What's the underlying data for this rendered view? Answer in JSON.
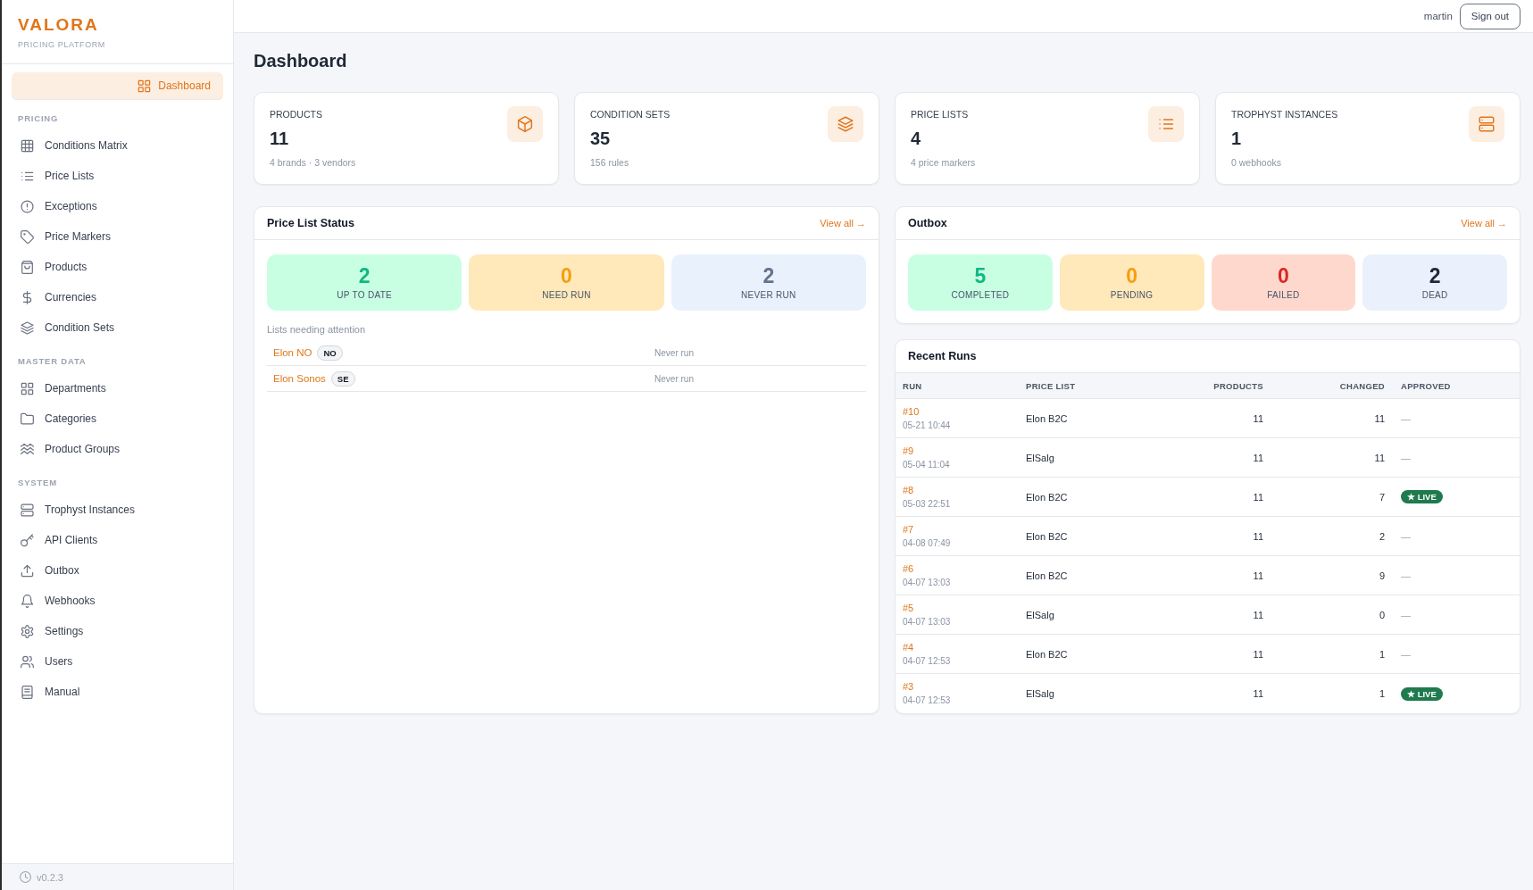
{
  "sidebar": {
    "logo": "VALORA",
    "tagline": "PRICING PLATFORM",
    "items": [
      {
        "label": "Dashboard",
        "selected": true
      }
    ],
    "sections": [
      {
        "title": "PRICING",
        "items": [
          {
            "label": "Conditions Matrix",
            "selected": false
          },
          {
            "label": "Price Lists",
            "selected": false
          },
          {
            "label": "Exceptions",
            "selected": false
          },
          {
            "label": "Price Markers",
            "selected": false
          },
          {
            "label": "Products",
            "selected": false
          },
          {
            "label": "Currencies",
            "selected": false
          },
          {
            "label": "Condition Sets",
            "selected": false
          }
        ]
      },
      {
        "title": "MASTER DATA",
        "items": [
          {
            "label": "Departments",
            "selected": false
          },
          {
            "label": "Categories",
            "selected": false
          },
          {
            "label": "Product Groups",
            "selected": false
          }
        ]
      },
      {
        "title": "SYSTEM",
        "items": [
          {
            "label": "Trophyst Instances",
            "selected": false
          },
          {
            "label": "API Clients",
            "selected": false
          },
          {
            "label": "Outbox",
            "selected": false
          },
          {
            "label": "Webhooks",
            "selected": false
          },
          {
            "label": "Settings",
            "selected": false
          },
          {
            "label": "Users",
            "selected": false
          },
          {
            "label": "Manual",
            "selected": false
          }
        ]
      }
    ],
    "version": "v0.2.3"
  },
  "top_bar": {
    "user": "martin",
    "sign_out": "Sign out"
  },
  "page_title": "Dashboard",
  "stat_cards": [
    {
      "label": "PRODUCTS",
      "value": "11",
      "detail": "4 brands · 3 vendors"
    },
    {
      "label": "CONDITION SETS",
      "value": "35",
      "detail": "156 rules"
    },
    {
      "label": "PRICE LISTS",
      "value": "4",
      "detail": "4 price markers"
    },
    {
      "label": "TROPHYST INSTANCES",
      "value": "1",
      "detail": "0 webhooks"
    }
  ],
  "price_list_status": {
    "title": "Price List Status",
    "link": "View all →",
    "tiles": [
      {
        "value": "2",
        "label": "UP TO DATE",
        "color": "#10b981"
      },
      {
        "value": "0",
        "label": "NEED RUN",
        "color": "#f59e0b"
      },
      {
        "value": "2",
        "label": "NEVER RUN",
        "color": "#64748b"
      }
    ],
    "attention_title": "Lists needing attention",
    "rows": [
      {
        "name": "Elon NO",
        "code": "NO",
        "status": "Never run"
      },
      {
        "name": "Elon Sonos",
        "code": "SE",
        "status": "Never run"
      }
    ]
  },
  "outbox": {
    "title": "Outbox",
    "link": "View all →",
    "tiles": [
      {
        "value": "5",
        "label": "COMPLETED",
        "color": "#10b981"
      },
      {
        "value": "0",
        "label": "PENDING",
        "color": "#f59e0b"
      },
      {
        "value": "0",
        "label": "FAILED",
        "color": "#dc2626"
      },
      {
        "value": "2",
        "label": "DEAD",
        "color": "#1e293b"
      }
    ]
  },
  "recent_runs": {
    "title": "Recent Runs",
    "columns": [
      "RUN",
      "PRICE LIST",
      "PRODUCTS",
      "CHANGED",
      "APPROVED"
    ],
    "rows": [
      {
        "run": "#10",
        "time": "05-21 10:44",
        "price_list": "Elon B2C",
        "products": "11",
        "changed": "11",
        "approved": {
          "kind": "none",
          "text": "—"
        }
      },
      {
        "run": "#9",
        "time": "05-04 11:04",
        "price_list": "ElSalg",
        "products": "11",
        "changed": "11",
        "approved": {
          "kind": "none",
          "text": "—"
        }
      },
      {
        "run": "#8",
        "time": "05-03 22:51",
        "price_list": "Elon B2C",
        "products": "11",
        "changed": "7",
        "approved": {
          "kind": "live",
          "text": "★ LIVE"
        }
      },
      {
        "run": "#7",
        "time": "04-08 07:49",
        "price_list": "Elon B2C",
        "products": "11",
        "changed": "2",
        "approved": {
          "kind": "none",
          "text": "—"
        }
      },
      {
        "run": "#6",
        "time": "04-07 13:03",
        "price_list": "Elon B2C",
        "products": "11",
        "changed": "9",
        "approved": {
          "kind": "none",
          "text": "—"
        }
      },
      {
        "run": "#5",
        "time": "04-07 13:03",
        "price_list": "ElSalg",
        "products": "11",
        "changed": "0",
        "approved": {
          "kind": "none",
          "text": "—"
        }
      },
      {
        "run": "#4",
        "time": "04-07 12:53",
        "price_list": "Elon B2C",
        "products": "11",
        "changed": "1",
        "approved": {
          "kind": "none",
          "text": "—"
        }
      },
      {
        "run": "#3",
        "time": "04-07 12:53",
        "price_list": "ElSalg",
        "products": "11",
        "changed": "1",
        "approved": {
          "kind": "live",
          "text": "★ LIVE"
        }
      }
    ]
  }
}
